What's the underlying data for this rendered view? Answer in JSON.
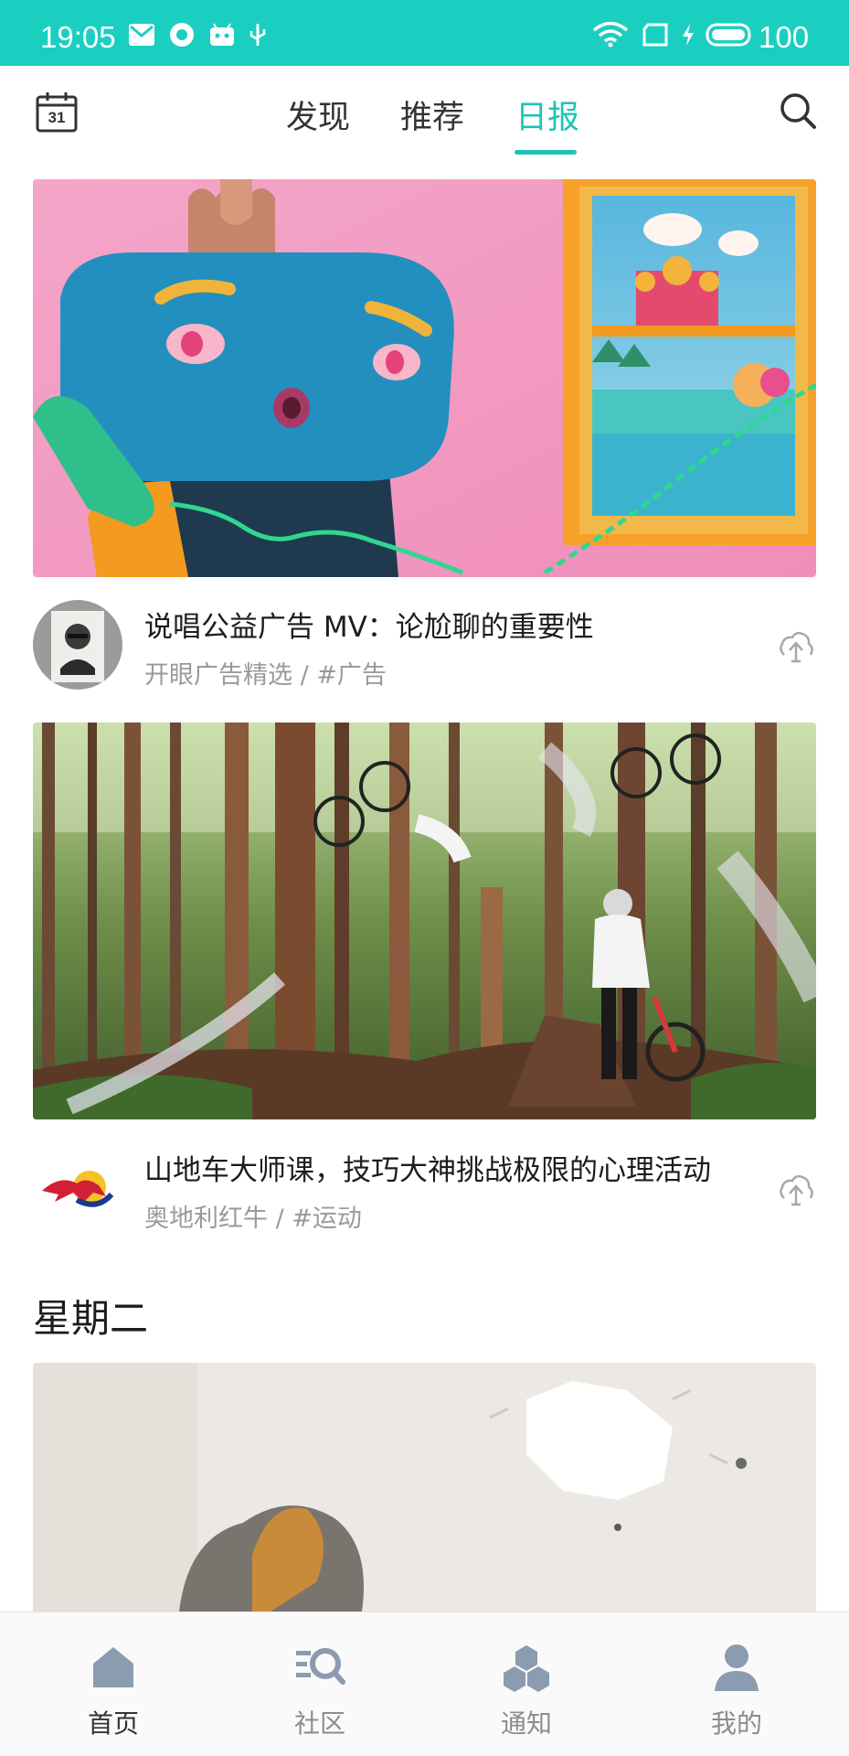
{
  "status_bar": {
    "time": "19:05",
    "battery": "100",
    "background_color": "#1bcfc0",
    "icons": [
      "mail-icon",
      "app-icon",
      "android-icon",
      "usb-icon",
      "wifi-icon",
      "sim-icon",
      "charging-icon",
      "battery-icon"
    ]
  },
  "top_nav": {
    "calendar_day": "31",
    "tabs": [
      {
        "label": "发现",
        "active": false
      },
      {
        "label": "推荐",
        "active": false
      },
      {
        "label": "日报",
        "active": true
      }
    ],
    "accent_color": "#1bc4b6"
  },
  "feed": [
    {
      "title": "说唱公益广告 MV：论尬聊的重要性",
      "meta": "开眼广告精选 / #广告",
      "image": "claymation-phone-character",
      "avatar": "author-portrait-avatar"
    },
    {
      "title": "山地车大师课，技巧大神挑战极限的心理活动",
      "meta": "奥地利红牛 / #运动",
      "image": "mountain-bike-forest",
      "avatar": "red-bull-logo"
    }
  ],
  "section": {
    "title": "星期二"
  },
  "bottom_nav": {
    "items": [
      {
        "label": "首页",
        "icon": "home-icon",
        "active": true
      },
      {
        "label": "社区",
        "icon": "community-search-icon",
        "active": false
      },
      {
        "label": "通知",
        "icon": "notification-cubes-icon",
        "active": false
      },
      {
        "label": "我的",
        "icon": "profile-icon",
        "active": false
      }
    ]
  }
}
